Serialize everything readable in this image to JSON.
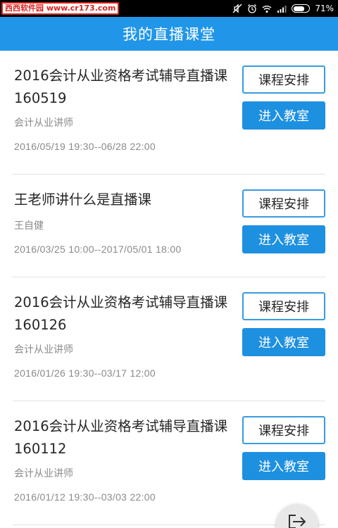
{
  "status_bar": {
    "watermark": "西西软件园 www.cr173.com",
    "battery_percent": "71%",
    "battery_level": 0.71,
    "icons": [
      "mute-icon",
      "alarm-icon",
      "wifi-icon",
      "signal-icon",
      "battery-icon"
    ]
  },
  "header": {
    "title": "我的直播课堂",
    "color": "#2196e8"
  },
  "courses": [
    {
      "title": "2016会计从业资格考试辅导直播课160519",
      "teacher": "会计从业讲师",
      "time": "2016/05/19 19:30--06/28 22:00",
      "schedule_label": "课程安排",
      "enter_label": "进入教室"
    },
    {
      "title": "王老师讲什么是直播课",
      "teacher": "王自健",
      "time": "2016/03/25 10:00--2017/05/01 18:00",
      "schedule_label": "课程安排",
      "enter_label": "进入教室"
    },
    {
      "title": "2016会计从业资格考试辅导直播课160126",
      "teacher": "会计从业讲师",
      "time": "2016/01/26 19:30--03/17 12:00",
      "schedule_label": "课程安排",
      "enter_label": "进入教室"
    },
    {
      "title": "2016会计从业资格考试辅导直播课160112",
      "teacher": "会计从业讲师",
      "time": "2016/01/12 19:30--03/03 22:00",
      "schedule_label": "课程安排",
      "enter_label": "进入教室"
    }
  ],
  "fab": {
    "icon": "logout-icon"
  }
}
